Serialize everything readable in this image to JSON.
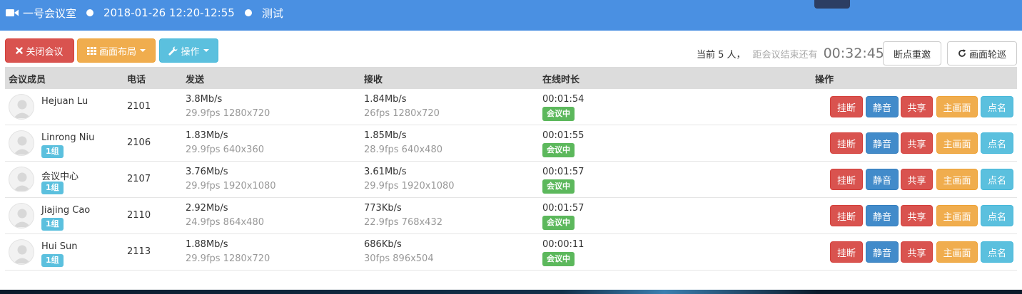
{
  "header": {
    "room": "一号会议室",
    "datetime": "2018-01-26 12:20-12:55",
    "meeting_name": "测试"
  },
  "toolbar": {
    "close_label": "关闭会议",
    "layout_label": "画面布局",
    "ops_label": "操作",
    "reconnect_label": "断点重邀",
    "rotate_label": "画面轮巡"
  },
  "status": {
    "count_text": "当前 5 人，",
    "remain_text": "距会议结束还有",
    "timer": "00:32:45"
  },
  "table": {
    "columns": [
      "会议成员",
      "电话",
      "发送",
      "接收",
      "在线时长",
      "操作"
    ],
    "rows": [
      {
        "name": "Hejuan Lu",
        "group": "",
        "phone": "2101",
        "send_rate": "3.8Mb/s",
        "send_detail": "29.9fps 1280x720",
        "recv_rate": "1.84Mb/s",
        "recv_detail": "26fps 1280x720",
        "duration": "00:01:54",
        "status": "会议中"
      },
      {
        "name": "Linrong Niu",
        "group": "1组",
        "phone": "2106",
        "send_rate": "1.83Mb/s",
        "send_detail": "29.9fps 640x360",
        "recv_rate": "1.85Mb/s",
        "recv_detail": "28.9fps 640x480",
        "duration": "00:01:55",
        "status": "会议中"
      },
      {
        "name": "会议中心",
        "group": "1组",
        "phone": "2107",
        "send_rate": "3.76Mb/s",
        "send_detail": "29.9fps 1920x1080",
        "recv_rate": "3.61Mb/s",
        "recv_detail": "29.9fps 1920x1080",
        "duration": "00:01:57",
        "status": "会议中"
      },
      {
        "name": "Jiajing Cao",
        "group": "1组",
        "phone": "2110",
        "send_rate": "2.92Mb/s",
        "send_detail": "24.9fps 864x480",
        "recv_rate": "773Kb/s",
        "recv_detail": "22.9fps 768x432",
        "duration": "00:01:57",
        "status": "会议中"
      },
      {
        "name": "Hui Sun",
        "group": "1组",
        "phone": "2113",
        "send_rate": "1.88Mb/s",
        "send_detail": "29.9fps 1280x720",
        "recv_rate": "686Kb/s",
        "recv_detail": "30fps 896x504",
        "duration": "00:00:11",
        "status": "会议中"
      }
    ],
    "actions": [
      "挂断",
      "静音",
      "共享",
      "主画面",
      "点名"
    ]
  },
  "colors": {
    "topbar": "#4a90e2",
    "danger": "#d9534f",
    "warning": "#f0ad4e",
    "info": "#5bc0de",
    "primary": "#428bca",
    "success": "#5cb85c"
  },
  "icons": {
    "room": "video-camera-icon",
    "close": "close-icon",
    "layout": "grid-icon",
    "ops": "wrench-icon",
    "rotate": "refresh-icon",
    "avatar": "user-avatar-icon"
  }
}
